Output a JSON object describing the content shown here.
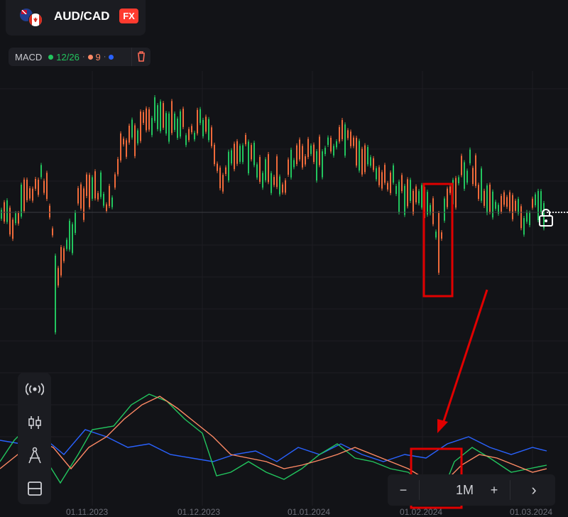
{
  "header": {
    "symbol": "AUD/CAD",
    "market_badge": "FX",
    "flags": [
      "australia-flag-icon",
      "canada-flag-icon"
    ]
  },
  "indicator": {
    "name": "MACD",
    "params": "12/26",
    "signal": "9",
    "colors": {
      "macd": "#22c55e",
      "signal": "#ff8a65",
      "hist": "#2962ff"
    }
  },
  "toolbar": {
    "items": [
      "signals-icon",
      "chart-type-icon",
      "drawing-tools-icon",
      "layout-icon"
    ]
  },
  "zoom": {
    "minus": "−",
    "period": "1M",
    "plus": "+",
    "next": "›"
  },
  "x_axis": {
    "labels": [
      "01.11.2023",
      "01.12.2023",
      "01.01.2024",
      "01.02.2024",
      "01.03.2024"
    ]
  },
  "annotations": {
    "box_color": "#e00000",
    "arrow_color": "#e00000"
  },
  "colors": {
    "up": "#22c55e",
    "down": "#ef6a3a",
    "background": "#121317"
  }
}
